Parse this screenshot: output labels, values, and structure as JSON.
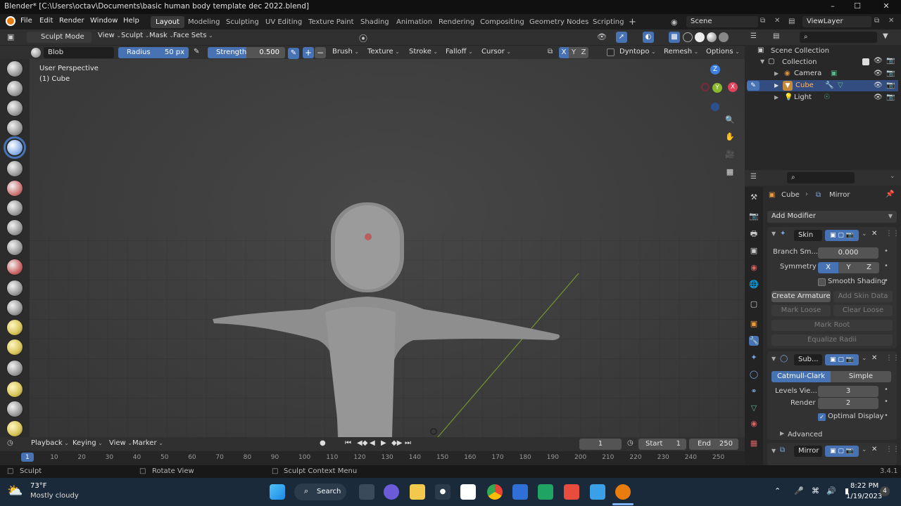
{
  "window": {
    "title": "Blender* [C:\\Users\\octav\\Documents\\basic human body template dec 2022.blend]",
    "minimize": "–",
    "maximize": "☐",
    "close": "✕"
  },
  "menu": [
    "File",
    "Edit",
    "Render",
    "Window",
    "Help"
  ],
  "workspaces": [
    {
      "label": "Layout",
      "active": true
    },
    {
      "label": "Modeling"
    },
    {
      "label": "Sculpting"
    },
    {
      "label": "UV Editing"
    },
    {
      "label": "Texture Paint"
    },
    {
      "label": "Shading"
    },
    {
      "label": "Animation"
    },
    {
      "label": "Rendering"
    },
    {
      "label": "Compositing"
    },
    {
      "label": "Geometry Nodes"
    },
    {
      "label": "Scripting"
    }
  ],
  "add_workspace": "+",
  "scene": {
    "label": "Scene",
    "view_layer": "ViewLayer"
  },
  "header": {
    "mode": "Sculpt Mode",
    "menus": [
      "View",
      "Sculpt",
      "Mask",
      "Face Sets"
    ]
  },
  "tool_settings": {
    "brush_name": "Blob",
    "radius_label": "Radius",
    "radius_value": "50 px",
    "strength_label": "Strength",
    "strength_value": "0.500",
    "plus": "+",
    "minus": "−",
    "dropdowns": [
      "Brush",
      "Texture",
      "Stroke",
      "Falloff",
      "Cursor"
    ],
    "axes": [
      "X",
      "Y",
      "Z"
    ],
    "dyntopo": "Dyntopo",
    "remesh": "Remesh",
    "options": "Options"
  },
  "viewport": {
    "perspective": "User Perspective",
    "object": "(1) Cube",
    "gizmo_axes": [
      "Z",
      "X",
      "Y"
    ]
  },
  "outliner": {
    "root": "Scene Collection",
    "collection": "Collection",
    "items": [
      {
        "label": "Camera",
        "selected": false
      },
      {
        "label": "Cube",
        "selected": true
      },
      {
        "label": "Light",
        "selected": false
      }
    ]
  },
  "properties": {
    "breadcrumb_object": "Cube",
    "breadcrumb_sep": "›",
    "breadcrumb_modifier": "Mirror",
    "add_modifier": "Add Modifier",
    "skin": {
      "name": "Skin",
      "branch_label": "Branch Sm...",
      "branch_value": "0.000",
      "symmetry_label": "Symmetry",
      "symmetry": [
        "X",
        "Y",
        "Z"
      ],
      "smooth_shading": "Smooth Shading",
      "create_armature": "Create Armature",
      "add_skin_data": "Add Skin Data",
      "mark_loose": "Mark Loose",
      "clear_loose": "Clear Loose",
      "mark_root": "Mark Root",
      "equalize_radii": "Equalize Radii"
    },
    "subsurf": {
      "name": "Sub...",
      "catmull": "Catmull-Clark",
      "simple": "Simple",
      "levels_label": "Levels Vie...",
      "levels_value": "3",
      "render_label": "Render",
      "render_value": "2",
      "optimal": "Optimal Display",
      "advanced": "Advanced"
    },
    "mirror": {
      "name": "Mirror"
    }
  },
  "timeline": {
    "menus": [
      "Playback",
      "Keying",
      "View",
      "Marker"
    ],
    "frame": "1",
    "start_label": "Start",
    "start_value": "1",
    "end_label": "End",
    "end_value": "250",
    "ticks": [
      "1",
      "10",
      "20",
      "30",
      "40",
      "50",
      "60",
      "70",
      "80",
      "90",
      "100",
      "110",
      "120",
      "130",
      "140",
      "150",
      "160",
      "170",
      "180",
      "190",
      "200",
      "210",
      "220",
      "230",
      "240",
      "250"
    ]
  },
  "status": {
    "left": "Sculpt",
    "mid": "Rotate View",
    "right": "Sculpt Context Menu",
    "version": "3.4.1"
  },
  "taskbar": {
    "weather_temp": "73°F",
    "weather_desc": "Mostly cloudy",
    "search": "Search",
    "time": "8:22 PM",
    "date": "1/19/2023",
    "notifications": "4"
  },
  "colors": {
    "accent": "#4772b3",
    "selected_row": "#334d80",
    "x_axis": "#e0425a",
    "y_axis": "#8ab82e",
    "z_axis": "#3d7fe0"
  }
}
